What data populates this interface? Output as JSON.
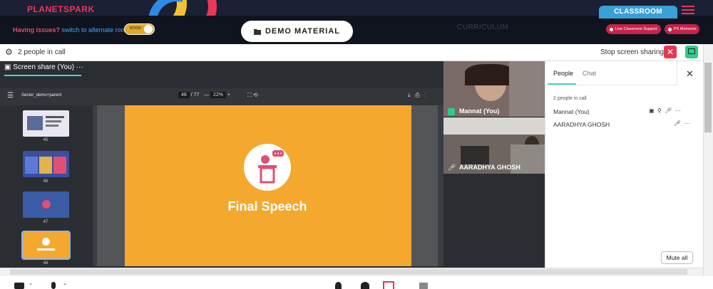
{
  "brand": {
    "name": "PLANETSPARK"
  },
  "header": {
    "issues_text": "Having issues?",
    "switch_text": "switch to alternate room",
    "toggle_label": "ROOM",
    "demo_button": "DEMO MATERIAL",
    "curriculum": "CURRICULUM",
    "classroom": "CLASSROOM",
    "support_pill": "Live Classroom Support",
    "moments_pill": "PS Moments"
  },
  "callbar": {
    "people_in_call": "2 people in call",
    "stop_sharing": "Stop screen sharing",
    "close_glyph": "✕"
  },
  "share": {
    "tab_label": "Screen share (You)",
    "more_glyph": "···"
  },
  "pdf": {
    "filename": "Senior_demo+parent",
    "current_page": "48",
    "total_pages": "/ 77",
    "zoom": "22%",
    "thumbnails": [
      "45",
      "46",
      "47",
      "48"
    ]
  },
  "slide": {
    "title": "Final Speech"
  },
  "videos": [
    {
      "name": "Mannat (You)"
    },
    {
      "name": "AARADHYA GHOSH"
    }
  ],
  "panel": {
    "tab_people": "People",
    "tab_chat": "Chat",
    "count": "2 people in call",
    "participants": [
      {
        "name": "Mannat (You)"
      },
      {
        "name": "AARADHYA GHOSH"
      }
    ],
    "mute_all": "Mute all"
  },
  "colors": {
    "accent": "#e8385a",
    "teal": "#4fd1c5",
    "slide_bg": "#f5a82e",
    "classroom_tab": "#3aa0d8"
  }
}
